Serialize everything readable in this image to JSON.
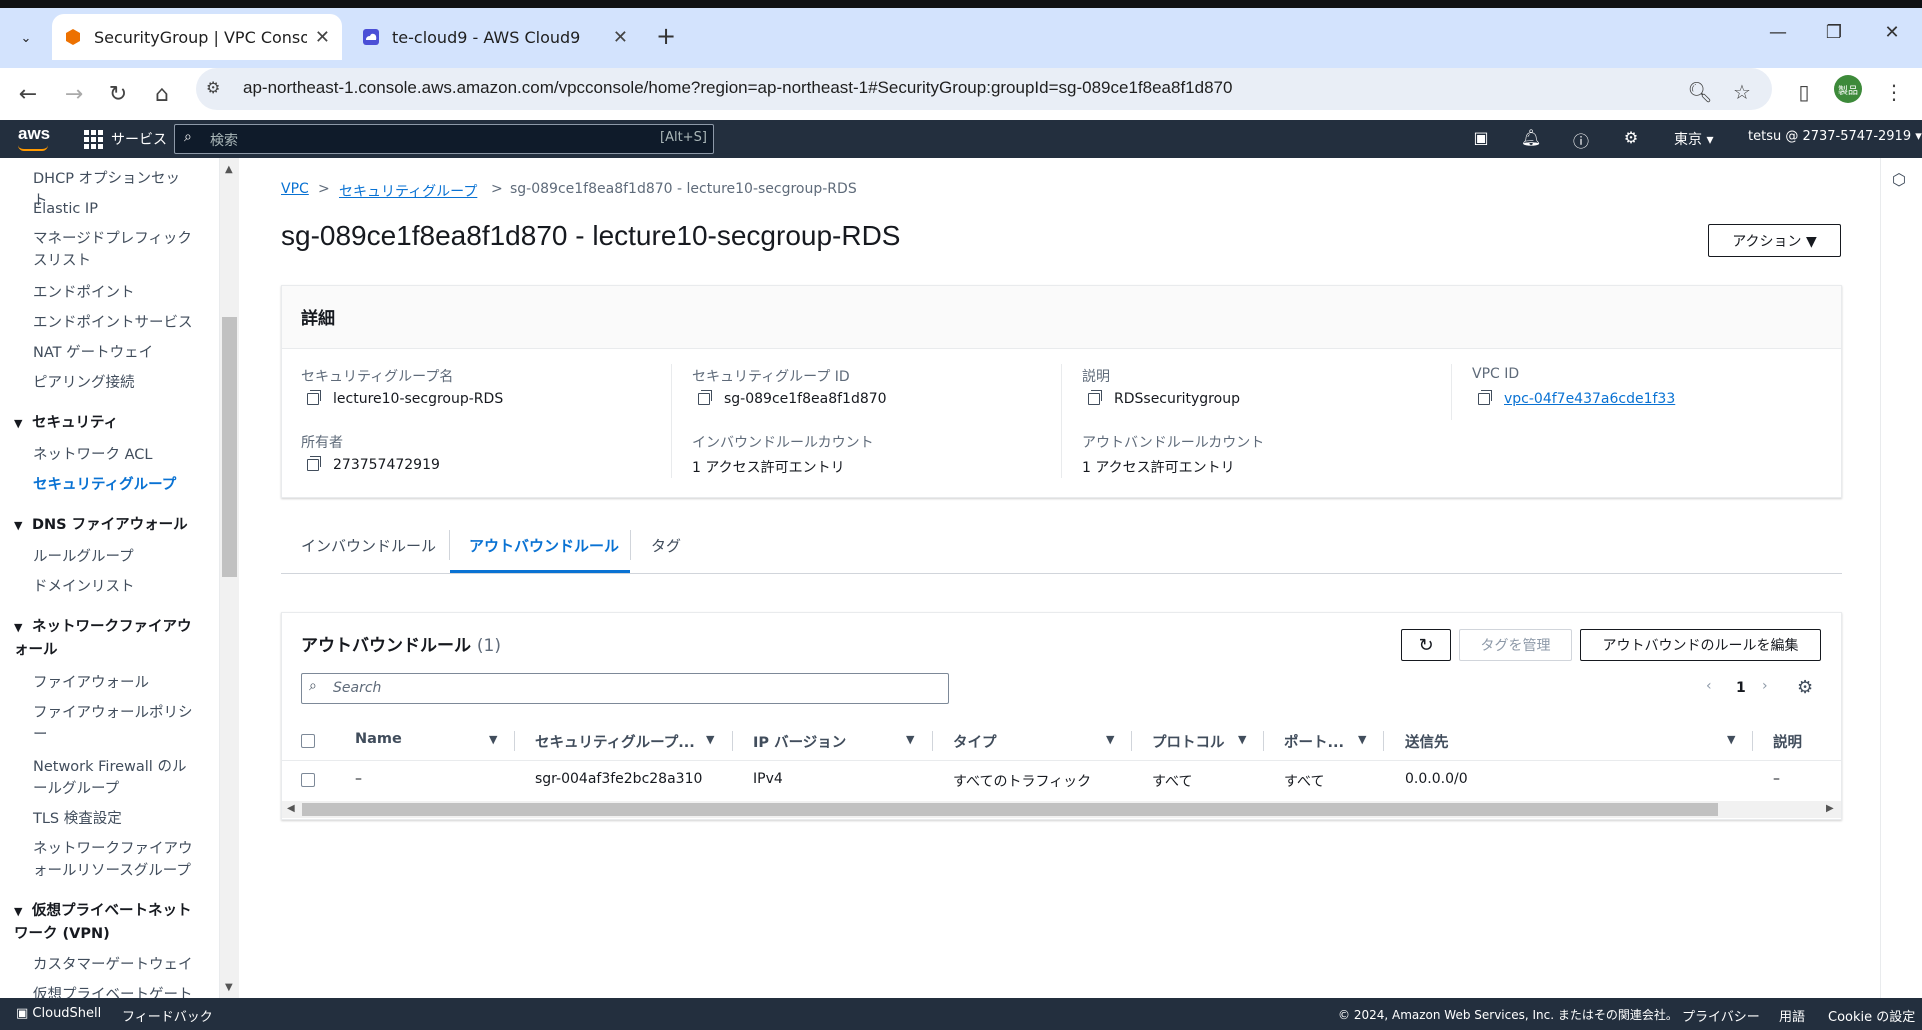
{
  "browser": {
    "tabs": [
      {
        "title": "SecurityGroup | VPC Console",
        "active": true
      },
      {
        "title": "te-cloud9 - AWS Cloud9",
        "active": false
      }
    ],
    "url": "ap-northeast-1.console.aws.amazon.com/vpcconsole/home?region=ap-northeast-1#SecurityGroup:groupId=sg-089ce1f8ea8f1d870",
    "profile_label": "製品"
  },
  "aws_header": {
    "logo": "aws",
    "services": "サービス",
    "search_placeholder": "検索",
    "search_shortcut": "[Alt+S]",
    "region": "東京 ▾",
    "account": "tetsu @ 2737-5747-2919 ▾"
  },
  "sidebar": {
    "items": [
      {
        "type": "item",
        "label": "DHCP オプションセット"
      },
      {
        "type": "item",
        "label": "Elastic IP"
      },
      {
        "type": "item",
        "label": "マネージドプレフィックスリスト"
      },
      {
        "type": "item",
        "label": "エンドポイント"
      },
      {
        "type": "item",
        "label": "エンドポイントサービス"
      },
      {
        "type": "item",
        "label": "NAT ゲートウェイ"
      },
      {
        "type": "item",
        "label": "ピアリング接続"
      },
      {
        "type": "head",
        "label": "セキュリティ"
      },
      {
        "type": "item",
        "label": "ネットワーク ACL"
      },
      {
        "type": "item",
        "label": "セキュリティグループ",
        "active": true
      },
      {
        "type": "head",
        "label": "DNS ファイアウォール"
      },
      {
        "type": "item",
        "label": "ルールグループ"
      },
      {
        "type": "item",
        "label": "ドメインリスト"
      },
      {
        "type": "head",
        "label": "ネットワークファイアウォール"
      },
      {
        "type": "item",
        "label": "ファイアウォール"
      },
      {
        "type": "item",
        "label": "ファイアウォールポリシー"
      },
      {
        "type": "item",
        "label": "Network Firewall のルールグループ"
      },
      {
        "type": "item",
        "label": "TLS 検査設定"
      },
      {
        "type": "item",
        "label": "ネットワークファイアウォールリソースグループ"
      },
      {
        "type": "head",
        "label": "仮想プライベートネットワーク (VPN)"
      },
      {
        "type": "item",
        "label": "カスタマーゲートウェイ"
      },
      {
        "type": "item",
        "label": "仮想プライベートゲートウェイ"
      }
    ]
  },
  "breadcrumb": {
    "vpc": "VPC",
    "sep": ">",
    "security_groups": "セキュリティグループ",
    "current": "sg-089ce1f8ea8f1d870 - lecture10-secgroup-RDS"
  },
  "page": {
    "title": "sg-089ce1f8ea8f1d870 - lecture10-secgroup-RDS",
    "actions_label": "アクション ▼"
  },
  "details": {
    "title": "詳細",
    "fields": {
      "sg_name_label": "セキュリティグループ名",
      "sg_name_value": "lecture10-secgroup-RDS",
      "sg_id_label": "セキュリティグループ ID",
      "sg_id_value": "sg-089ce1f8ea8f1d870",
      "desc_label": "説明",
      "desc_value": "RDSsecuritygroup",
      "vpc_label": "VPC ID",
      "vpc_value": "vpc-04f7e437a6cde1f33",
      "owner_label": "所有者",
      "owner_value": "273757472919",
      "inbound_count_label": "インバウンドルールカウント",
      "inbound_count_value": "1 アクセス許可エントリ",
      "outbound_count_label": "アウトバンドルールカウント",
      "outbound_count_value": "1 アクセス許可エントリ"
    }
  },
  "tabs": {
    "inbound": "インバウンドルール",
    "outbound": "アウトバウンドルール",
    "tags": "タグ"
  },
  "rules": {
    "title": "アウトバウンドルール",
    "count": "(1)",
    "manage_tags": "タグを管理",
    "edit_outbound": "アウトバウンドのルールを編集",
    "search_placeholder": "Search",
    "page": "1",
    "columns": {
      "name": "Name",
      "sg_rule_id": "セキュリティグループ...",
      "ip_version": "IP バージョン",
      "type": "タイプ",
      "protocol": "プロトコル",
      "port": "ポート...",
      "destination": "送信先",
      "description": "説明"
    },
    "rows": [
      {
        "name": "–",
        "sg_rule_id": "sgr-004af3fe2bc28a310",
        "ip_version": "IPv4",
        "type": "すべてのトラフィック",
        "protocol": "すべて",
        "port": "すべて",
        "destination": "0.0.0.0/0",
        "description": "–"
      }
    ]
  },
  "footer": {
    "cloudshell": "CloudShell",
    "feedback": "フィードバック",
    "copyright": "© 2024, Amazon Web Services, Inc. またはその関連会社。",
    "privacy": "プライバシー",
    "terms": "用語",
    "cookie": "Cookie の設定"
  }
}
